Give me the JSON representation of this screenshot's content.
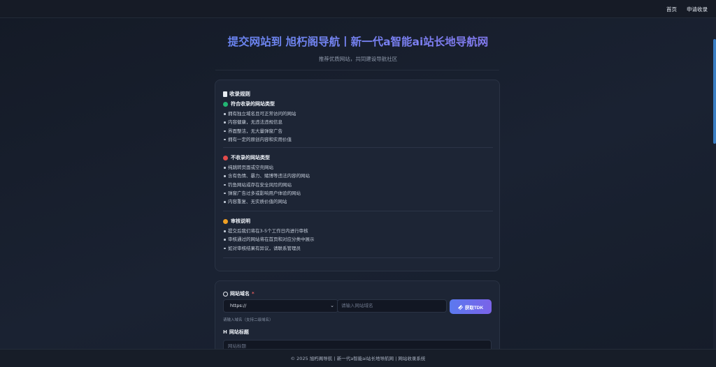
{
  "nav": {
    "home": "首页",
    "apply": "申请收录"
  },
  "hero": {
    "title": "提交网站到 旭朽阁导航丨新一代a智能ai站长地导航网",
    "subtitle": "推荐优质网站，共同建设导航社区"
  },
  "rules": {
    "heading": "收录规则",
    "accept": {
      "title": "符合收录的网站类型",
      "items": [
        "拥有独立域名且可正常访问的网站",
        "内容健康，无违法违规信息",
        "界面整洁，无大量弹窗广告",
        "拥有一定的原创内容和实用价值"
      ]
    },
    "reject": {
      "title": "不收录的网站类型",
      "items": [
        "纯跳转页面或空壳网站",
        "含有色情、暴力、赌博等违法内容的网站",
        "钓鱼网站或存在安全风险的网站",
        "弹窗广告过多或影响用户体验的网站",
        "内容重复、无实质价值的网站"
      ]
    },
    "review": {
      "title": "审核说明",
      "items": [
        "提交后我们将在3-5个工作日内进行审核",
        "审核通过的网站将在首页和对应分类中展示",
        "如对审核结果有异议，请联系管理员"
      ]
    }
  },
  "form": {
    "domain_label": "网站域名",
    "required_mark": "*",
    "protocol_value": "https://",
    "domain_placeholder": "请输入网站域名",
    "tdk_button": "获取TDK",
    "domain_hint": "请输入域名（支持二级域名）",
    "title_label": "网站标题",
    "title_placeholder": "网站标题"
  },
  "footer": {
    "text": "© 2025 旭朽阁导航丨新一代a智能ai站长地导航网 | 网站收录系统"
  },
  "colors": {
    "accent": "#5b7ff0",
    "accept_dot": "#22b573",
    "reject_dot": "#e34b4b",
    "review_dot": "#f0a024"
  }
}
